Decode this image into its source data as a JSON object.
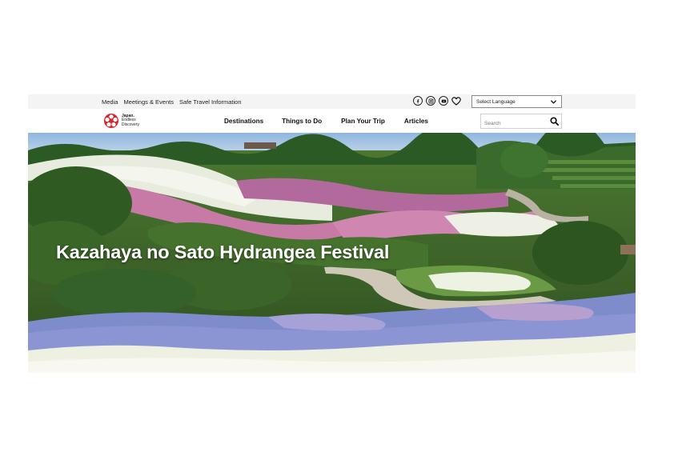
{
  "utility_bar": {
    "links": [
      "Media",
      "Meetings & Events",
      "Safe Travel Information"
    ],
    "social_icons": [
      "facebook-icon",
      "instagram-icon",
      "youtube-icon",
      "heart-icon"
    ],
    "language_select": {
      "selected": "Select Language"
    }
  },
  "header": {
    "logo": {
      "line1": "Japan.",
      "line2": "Endless",
      "line3": "Discovery"
    },
    "nav": [
      "Destinations",
      "Things to Do",
      "Plan Your Trip",
      "Articles"
    ],
    "search": {
      "placeholder": "Search"
    }
  },
  "hero": {
    "title": "Kazahaya no Sato Hydrangea Festival"
  },
  "colors": {
    "brand_red": "#d7262d",
    "utility_bg": "#f4f4f4",
    "text": "#111111"
  }
}
